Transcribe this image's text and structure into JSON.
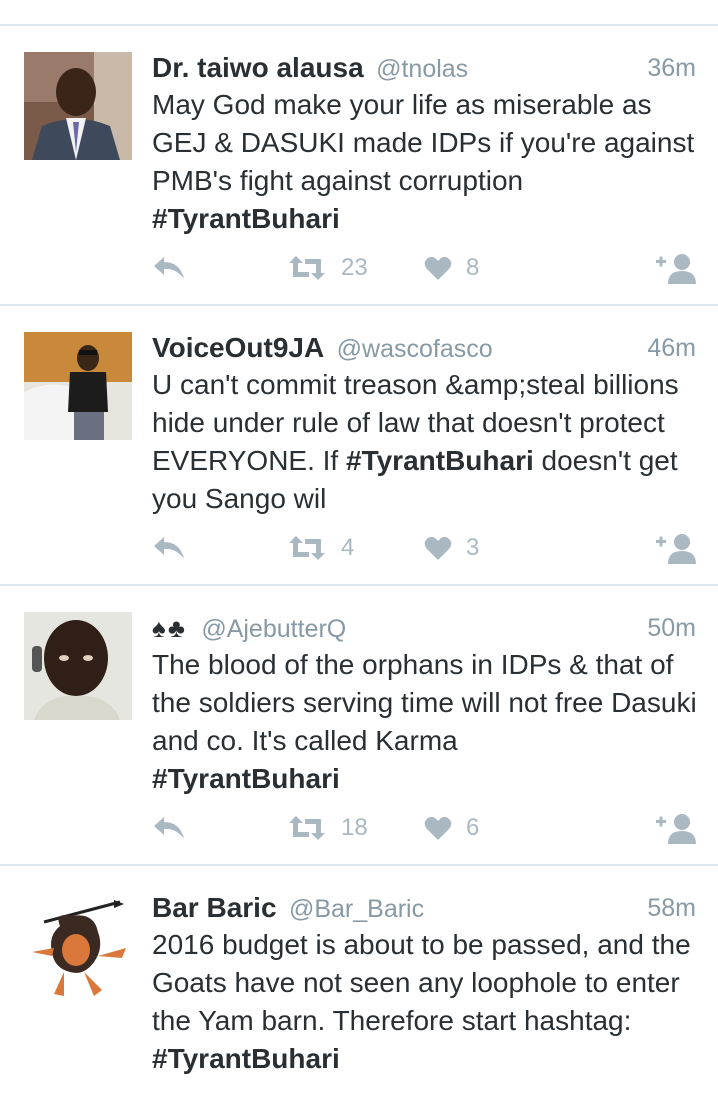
{
  "tweets": [
    {
      "display_name": "Dr. taiwo alausa",
      "handle": "@tnolas",
      "time": "36m",
      "text": "May God make your life as miserable as GEJ & DASUKI made IDPs if you're against PMB's fight against corruption",
      "hashtag": "#TyrantBuhari",
      "retweets": "23",
      "likes": "8"
    },
    {
      "display_name": "VoiceOut9JA",
      "handle": "@wascofasco",
      "time": "46m",
      "text": "U can't commit treason &amp;steal billions hide under rule of law that doesn't protect EVERYONE. If",
      "hashtag": "#TyrantBuhari",
      "text_after": "doesn't get you Sango wil",
      "retweets": "4",
      "likes": "3"
    },
    {
      "display_name": "♠♣",
      "handle": "@AjebutterQ",
      "time": "50m",
      "text": "The blood of the orphans in IDPs & that of the soldiers serving time will not free Dasuki and co. It's called Karma",
      "hashtag": "#TyrantBuhari",
      "retweets": "18",
      "likes": "6"
    },
    {
      "display_name": "Bar Baric",
      "handle": "@Bar_Baric",
      "time": "58m",
      "text": "2016 budget is about to be passed, and the Goats have not seen any loophole to enter the Yam barn. Therefore start hashtag:",
      "hashtag": "#TyrantBuhari"
    }
  ],
  "icons": {
    "reply": "reply-icon",
    "retweet": "retweet-icon",
    "like": "heart-icon",
    "follow": "follow-icon"
  },
  "colors": {
    "text": "#292f33",
    "muted": "#8899a6",
    "icon": "#aab8c2",
    "divider": "#e1e8ed"
  }
}
